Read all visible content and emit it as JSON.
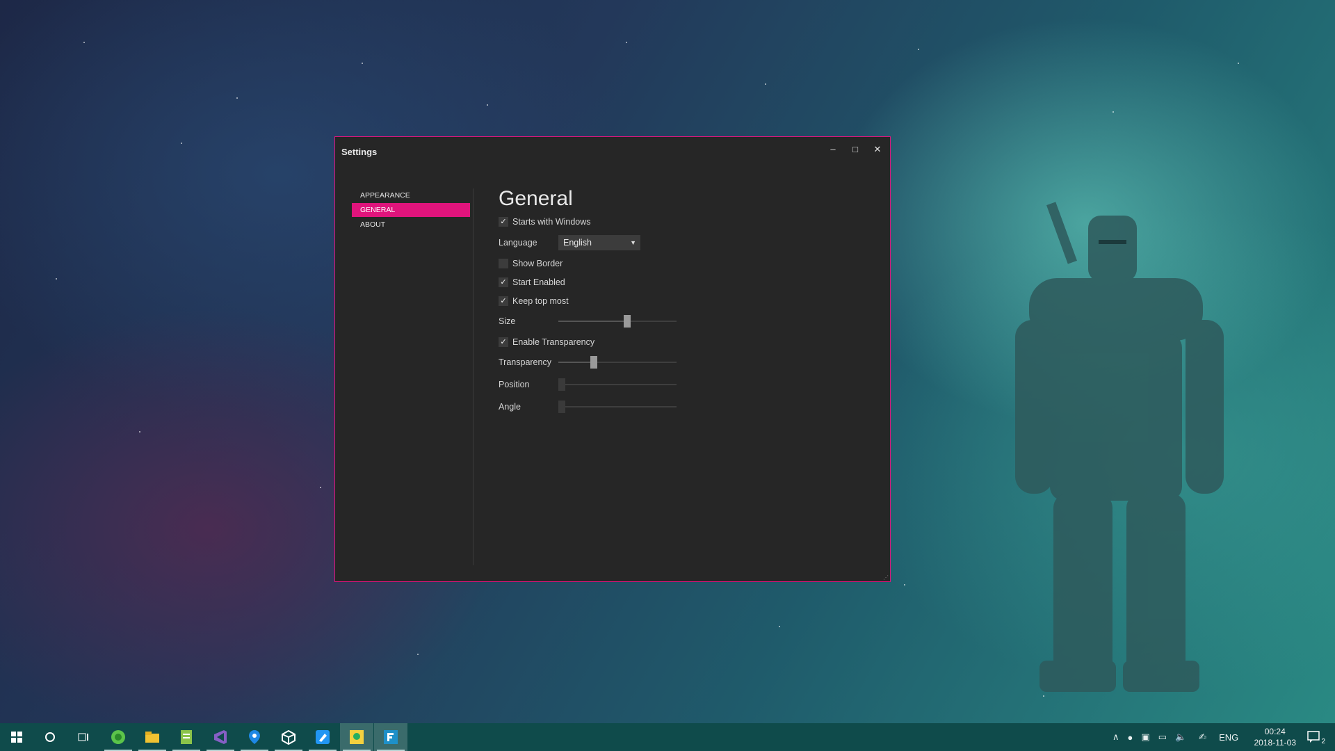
{
  "window": {
    "title": "Settings",
    "minimize": "–",
    "maximize": "□",
    "close": "✕"
  },
  "nav": {
    "items": [
      {
        "label": "APPEARANCE"
      },
      {
        "label": "GENERAL"
      },
      {
        "label": "ABOUT"
      }
    ],
    "selected": "GENERAL"
  },
  "general": {
    "heading": "General",
    "starts_with_windows": {
      "label": "Starts with Windows",
      "checked": true
    },
    "language": {
      "label": "Language",
      "value": "English"
    },
    "show_border": {
      "label": "Show Border",
      "checked": false
    },
    "start_enabled": {
      "label": "Start Enabled",
      "checked": true
    },
    "keep_top_most": {
      "label": "Keep top most",
      "checked": true
    },
    "size": {
      "label": "Size",
      "value_fraction": 0.58
    },
    "enable_transparency": {
      "label": "Enable Transparency",
      "checked": true
    },
    "transparency": {
      "label": "Transparency",
      "value_fraction": 0.3
    },
    "position": {
      "label": "Position",
      "value_fraction": 0.0
    },
    "angle": {
      "label": "Angle",
      "value_fraction": 0.0
    }
  },
  "taskbar": {
    "start_icon": "windows-logo-icon",
    "search_icon": "cortana-circle-icon",
    "apps": [
      "task-view-icon",
      "browser-icon",
      "file-explorer-icon",
      "notepad-icon",
      "visual-studio-icon",
      "maps-icon",
      "unity-icon",
      "paint-icon",
      "image-app-icon",
      "app-f-icon"
    ],
    "tray": {
      "language": "ENG",
      "time": "00:24",
      "date": "2018-11-03",
      "notifications": "2"
    }
  },
  "colors": {
    "accent": "#e0147c",
    "window_bg": "#262626",
    "taskbar_bg": "#0f4b4b"
  }
}
